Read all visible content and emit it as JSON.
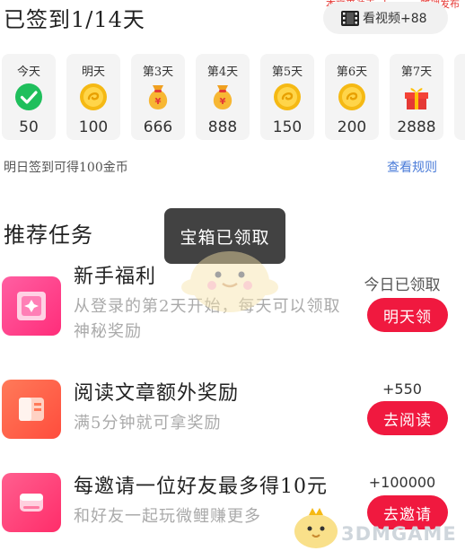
{
  "watermark": "本文来源于 zhua.cn 整理发布",
  "header": {
    "signed_title": "已签到1/14天",
    "watch_video_label": "看视频+88",
    "watch_icon": "film-icon"
  },
  "checkin_days": [
    {
      "label": "今天",
      "value": "50",
      "icon": "check-icon",
      "state": "claimed"
    },
    {
      "label": "明天",
      "value": "100",
      "icon": "coin-icon"
    },
    {
      "label": "第3天",
      "value": "666",
      "icon": "money-bag-icon"
    },
    {
      "label": "第4天",
      "value": "888",
      "icon": "money-bag-icon"
    },
    {
      "label": "第5天",
      "value": "150",
      "icon": "coin-icon"
    },
    {
      "label": "第6天",
      "value": "200",
      "icon": "coin-icon"
    },
    {
      "label": "第7天",
      "value": "2888",
      "icon": "gift-icon"
    }
  ],
  "tomorrow_hint": "明日签到可得100金币",
  "view_rules": "查看规则",
  "section_title": "推荐任务",
  "toast": "宝箱已领取",
  "tasks": [
    {
      "title": "新手福利",
      "desc": "从登录的第2天开始，每天可以领取神秘奖励",
      "reward": "今日已领取",
      "button": "明天领",
      "icon": "gift-box-icon"
    },
    {
      "title": "阅读文章额外奖励",
      "desc": "满5分钟就可拿奖励",
      "reward": "+550",
      "button": "去阅读",
      "icon": "book-icon"
    },
    {
      "title": "每邀请一位好友最多得10元",
      "desc": "和好友一起玩微鲤赚更多",
      "reward": "+100000",
      "button": "去邀请",
      "icon": "invite-icon"
    }
  ],
  "brand": "3DMGAME",
  "colors": {
    "accent_red": "#f0193f",
    "link_blue": "#4a7bd8",
    "check_green": "#1fbf5c",
    "coin_gold": "#f5b914"
  }
}
